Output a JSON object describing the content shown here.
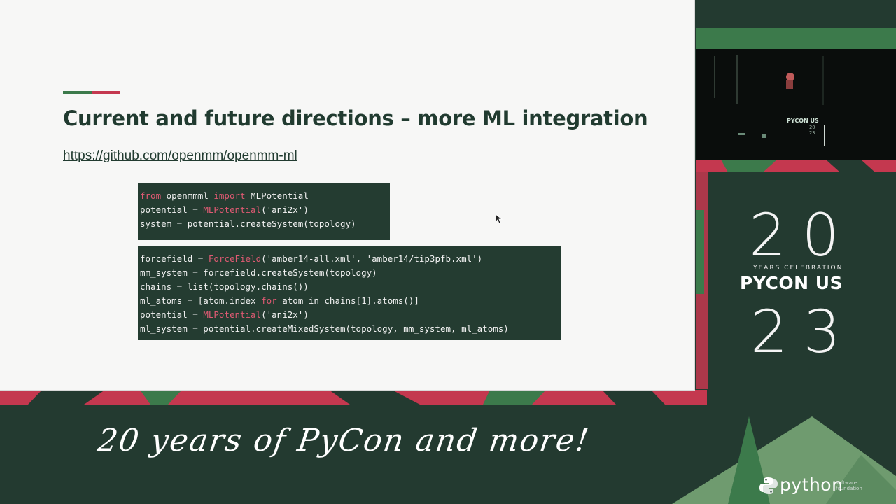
{
  "slide": {
    "title": "Current and future directions – more ML integration",
    "link": "https://github.com/openmm/openmm-ml",
    "code_block_1": [
      [
        {
          "t": "from",
          "kw": true
        },
        {
          "t": " openmmml ",
          "kw": false
        },
        {
          "t": "import",
          "kw": true
        },
        {
          "t": " MLPotential",
          "kw": false
        }
      ],
      [
        {
          "t": "potential = ",
          "kw": false
        },
        {
          "t": "MLPotential",
          "kw": true
        },
        {
          "t": "('ani2x')",
          "kw": false
        }
      ],
      [
        {
          "t": "system = potential.createSystem(topology)",
          "kw": false
        }
      ]
    ],
    "code_block_2": [
      [
        {
          "t": "forcefield = ",
          "kw": false
        },
        {
          "t": "ForceField",
          "kw": true
        },
        {
          "t": "('amber14-all.xml', 'amber14/tip3pfb.xml')",
          "kw": false
        }
      ],
      [
        {
          "t": "mm_system = forcefield.createSystem(topology)",
          "kw": false
        }
      ],
      [
        {
          "t": "chains = list(topology.chains())",
          "kw": false
        }
      ],
      [
        {
          "t": "ml_atoms = [atom.index ",
          "kw": false
        },
        {
          "t": "for",
          "kw": true
        },
        {
          "t": " atom in chains[1].atoms()]",
          "kw": false
        }
      ],
      [
        {
          "t": "potential = ",
          "kw": false
        },
        {
          "t": "MLPotential",
          "kw": true
        },
        {
          "t": "('ani2x')",
          "kw": false
        }
      ],
      [
        {
          "t": "ml_system = potential.createMixedSystem(topology, mm_system, ml_atoms)",
          "kw": false
        }
      ]
    ]
  },
  "camera": {
    "banner": "PYCON US",
    "year_lines": [
      "20",
      "23"
    ]
  },
  "branding": {
    "year_top": "20",
    "celebration": "YEARS CELEBRATION",
    "event": "PYCON US",
    "year_bottom": "23",
    "tagline": "20 years of PyCon and more!",
    "python_word": "python",
    "python_sub": [
      "software",
      "foundation"
    ]
  },
  "icons": [
    "cursor-arrow-icon",
    "python-logo-icon"
  ],
  "colors": {
    "bg_dark_green": "#233a30",
    "accent_red": "#c4384f",
    "accent_green": "#3c7a4b",
    "code_bg": "#243c31",
    "keyword": "#e05a73"
  }
}
